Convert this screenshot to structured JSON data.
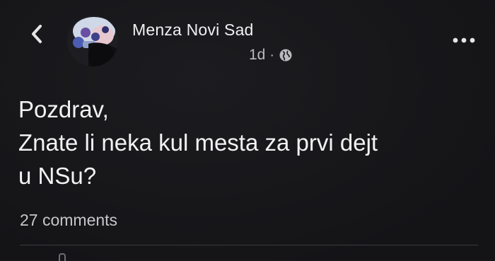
{
  "post": {
    "page_name": "Menza Novi Sad",
    "timestamp": "1d",
    "separator": "·",
    "privacy_icon": "globe-icon",
    "lines": [
      "Pozdrav,",
      "Znate li neka kul mesta za prvi dejt",
      "u NSu?"
    ],
    "comments_label": "27 comments"
  },
  "header": {
    "back_icon": "chevron-left-icon",
    "more_icon": "more-dots-icon"
  },
  "colors": {
    "background": "#17171b",
    "text_primary": "#f2f2f4",
    "text_secondary": "#b9b9be"
  }
}
